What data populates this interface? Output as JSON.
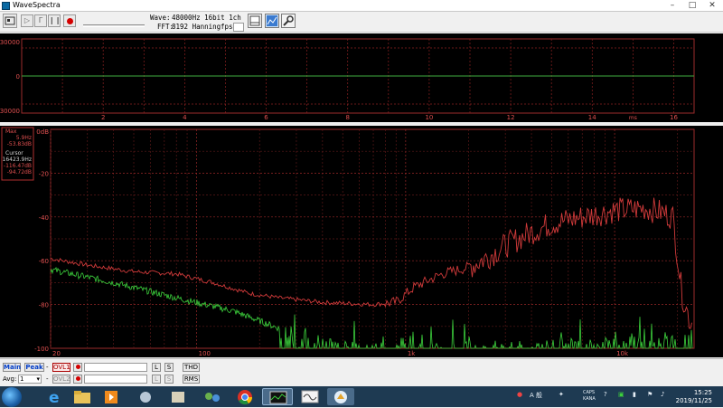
{
  "window": {
    "title": "WaveSpectra"
  },
  "toolbar": {
    "wave_label": "Wave:",
    "wave_value": "48000Hz 16bit 1ch",
    "fft_label": "FFT:",
    "fft_value": "8192 Hanning",
    "fps_label": "fps:"
  },
  "waveform": {
    "y_ticks": [
      "30000",
      "0",
      "-30000"
    ],
    "x_ticks": [
      "2",
      "4",
      "6",
      "8",
      "10",
      "12",
      "14",
      "16"
    ],
    "x_unit": "ms",
    "trace_color": "#3fae3f"
  },
  "spectrum": {
    "y_ticks": [
      "0dB",
      "-20",
      "-40",
      "-60",
      "-80",
      "-100"
    ],
    "x_ticks": [
      "20",
      "100",
      "1k",
      "10k"
    ],
    "info": {
      "max_label": "Max",
      "max_freq": "5.9Hz",
      "max_db": "-53.83dB",
      "cursor_label": "Cursor",
      "cursor_freq": "16423.9Hz",
      "cursor_db": "-116.47dB",
      "cursor_db2": "-94.72dB"
    },
    "colors": {
      "red": "#d03a3a",
      "green": "#3cd03c"
    }
  },
  "bottom": {
    "main_btn": "Main",
    "peak_btn": "Peak",
    "ovl1": "OVL1",
    "ovl2": "OVL2",
    "avg_label": "Avg:",
    "avg_value": "1",
    "l_btn": "L",
    "s_btn": "S",
    "thd_btn": "THD",
    "rms_btn": "RMS"
  },
  "taskbar": {
    "time": "15:25",
    "date": "2019/11/25",
    "ime": "A 般",
    "caps": "CAPS",
    "kana": "KANA"
  }
}
